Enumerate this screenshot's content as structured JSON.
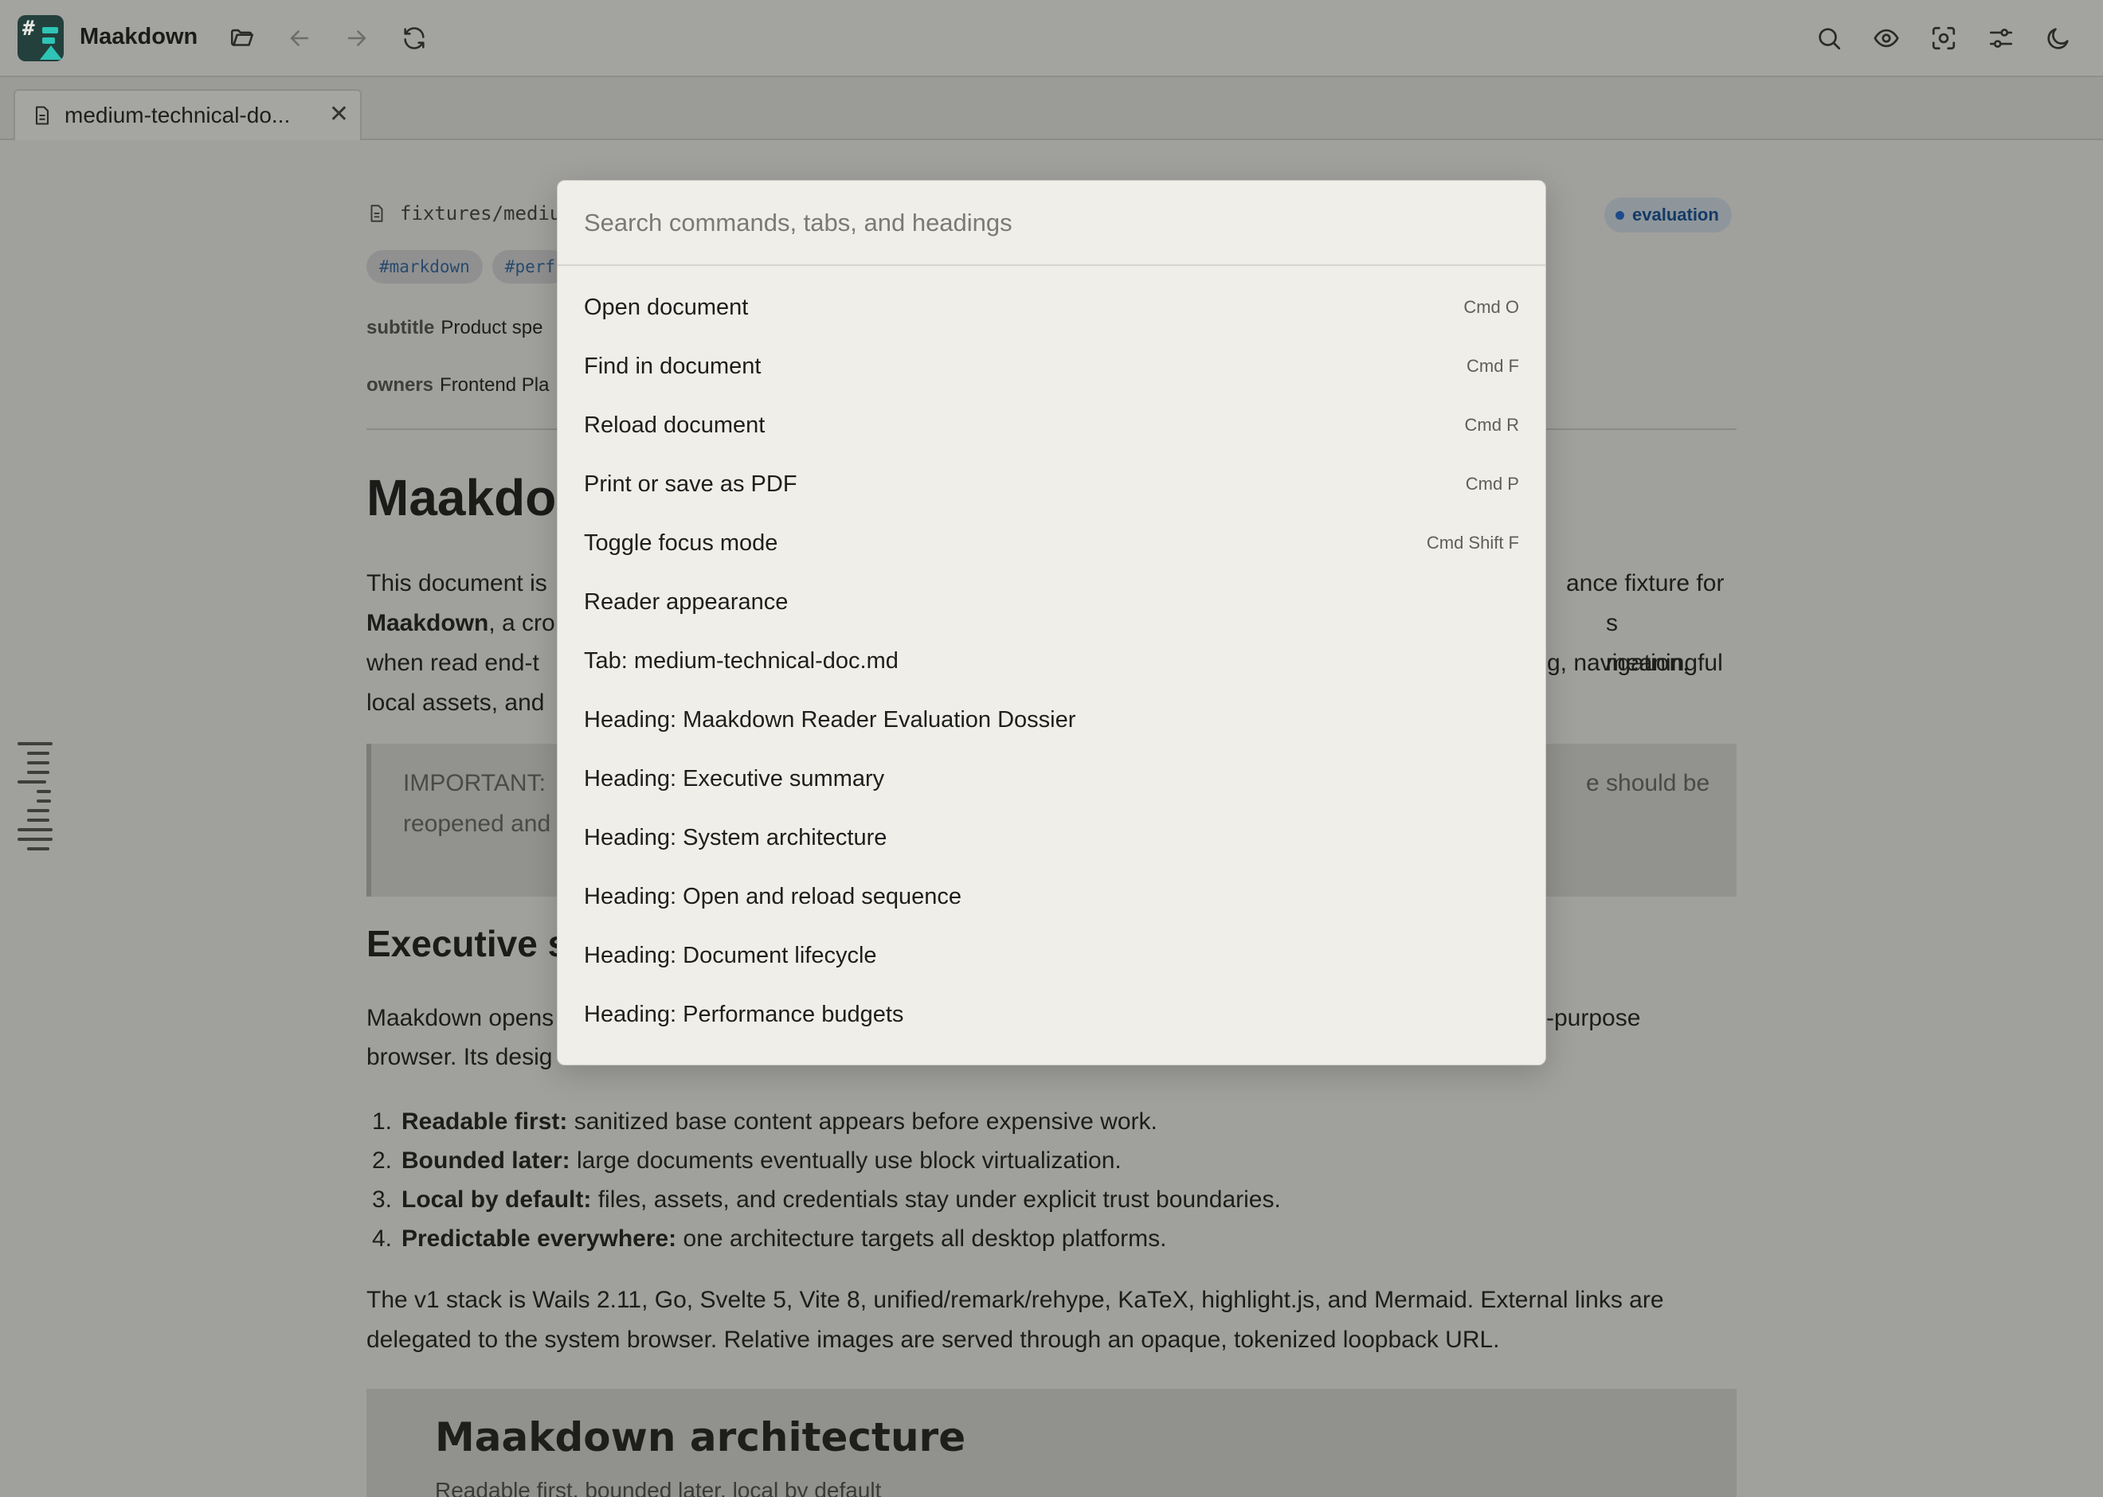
{
  "app": {
    "name": "Maakdown"
  },
  "tab": {
    "label": "medium-technical-do...",
    "close": "✕"
  },
  "doc": {
    "path": "fixtures/mediu",
    "status_badge": "evaluation",
    "tags": [
      "#markdown",
      "#perf"
    ],
    "subtitle_key": "subtitle",
    "subtitle_value": "Product spe",
    "owners_key": "owners",
    "owners_value": "Frontend Pla",
    "title": "Maakdo",
    "para1": {
      "l1a": "This document is",
      "l1b": "ance fixture for",
      "l2a": "Maakdown",
      "l2b": ", a cro",
      "l2c": "s meaningful",
      "l3a": "when read end-t",
      "l3b": "g, navigation,",
      "l4a": "local assets, and"
    },
    "callout": {
      "l1a": "IMPORTANT: ",
      "l1b": "e should be",
      "l2a": "reopened and"
    },
    "section_title": "Executive s",
    "para2": {
      "l1a": "Maakdown opens",
      "l1b": "-purpose",
      "l2a": "browser. Its desig"
    },
    "list": [
      {
        "num": "1.",
        "bold": "Readable first:",
        "text": " sanitized base content appears before expensive work."
      },
      {
        "num": "2.",
        "bold": "Bounded later:",
        "text": " large documents eventually use block virtualization."
      },
      {
        "num": "3.",
        "bold": "Local by default:",
        "text": " files, assets, and credentials stay under explicit trust boundaries."
      },
      {
        "num": "4.",
        "bold": "Predictable everywhere:",
        "text": " one architecture targets all desktop platforms."
      }
    ],
    "para3": "The v1 stack is Wails 2.11, Go, Svelte 5, Vite 8, unified/remark/rehype, KaTeX, highlight.js, and Mermaid. External links are delegated to the system browser. Relative images are served through an opaque, tokenized loopback URL.",
    "arch_title": "Maakdown architecture",
    "arch_subtitle": "Readable first, bounded later, local by default"
  },
  "palette": {
    "placeholder": "Search commands, tabs, and headings",
    "items": [
      {
        "label": "Open document",
        "shortcut": "Cmd O"
      },
      {
        "label": "Find in document",
        "shortcut": "Cmd F"
      },
      {
        "label": "Reload document",
        "shortcut": "Cmd R"
      },
      {
        "label": "Print or save as PDF",
        "shortcut": "Cmd P"
      },
      {
        "label": "Toggle focus mode",
        "shortcut": "Cmd Shift F"
      },
      {
        "label": "Reader appearance",
        "shortcut": ""
      },
      {
        "label": "Tab: medium-technical-doc.md",
        "shortcut": ""
      },
      {
        "label": "Heading: Maakdown Reader Evaluation Dossier",
        "shortcut": ""
      },
      {
        "label": "Heading: Executive summary",
        "shortcut": ""
      },
      {
        "label": "Heading: System architecture",
        "shortcut": ""
      },
      {
        "label": "Heading: Open and reload sequence",
        "shortcut": ""
      },
      {
        "label": "Heading: Document lifecycle",
        "shortcut": ""
      },
      {
        "label": "Heading: Performance budgets",
        "shortcut": ""
      }
    ]
  },
  "icons": {
    "toolbar_left": [
      "open-folder-icon",
      "back-arrow-icon",
      "forward-arrow-icon",
      "reload-icon"
    ],
    "toolbar_right": [
      "search-icon",
      "eye-icon",
      "focus-icon",
      "settings-sliders-icon",
      "moon-icon"
    ]
  }
}
